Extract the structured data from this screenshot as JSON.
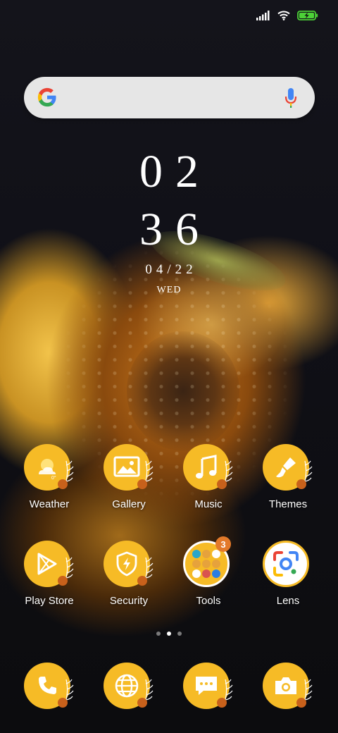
{
  "status_bar": {
    "icons": [
      "signal-icon",
      "wifi-icon",
      "battery-charging-icon"
    ],
    "battery_color": "#4cd137"
  },
  "search": {
    "logo": "google-g-icon",
    "mic": "microphone-icon"
  },
  "clock": {
    "hours": "02",
    "minutes": "36",
    "date": "04/22",
    "day": "WED"
  },
  "apps": {
    "row1": [
      {
        "label": "Weather",
        "icon": "weather-icon"
      },
      {
        "label": "Gallery",
        "icon": "gallery-icon"
      },
      {
        "label": "Music",
        "icon": "music-icon"
      },
      {
        "label": "Themes",
        "icon": "themes-brush-icon"
      }
    ],
    "row2": [
      {
        "label": "Play Store",
        "icon": "play-store-icon"
      },
      {
        "label": "Security",
        "icon": "security-shield-icon"
      },
      {
        "label": "Tools",
        "icon": "tools-folder-icon",
        "badge": "3"
      },
      {
        "label": "Lens",
        "icon": "lens-icon"
      }
    ]
  },
  "dock": [
    {
      "icon": "phone-icon"
    },
    {
      "icon": "browser-globe-icon"
    },
    {
      "icon": "messages-icon"
    },
    {
      "icon": "camera-icon"
    }
  ],
  "pager": {
    "count": 3,
    "active": 1
  },
  "colors": {
    "icon_bg": "#f6bb26",
    "berry": "#c8611b",
    "badge": "#e37a2a"
  }
}
